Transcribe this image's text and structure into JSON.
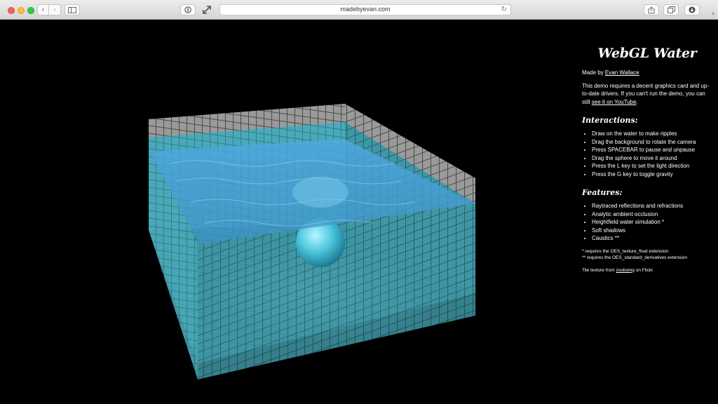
{
  "browser": {
    "url": "madebyevan.com",
    "icons": {
      "back": "chevron-left-icon",
      "forward": "chevron-right-icon",
      "sidebar": "sidebar-icon",
      "reader": "reader-icon",
      "fullscreen": "expand-icon",
      "reload": "reload-icon",
      "share": "share-icon",
      "tabs": "tabs-icon",
      "downloads": "download-icon",
      "new_tab": "plus-icon"
    }
  },
  "scene": {
    "description_icon": "pool-water-sphere-scene",
    "colors": {
      "water": "#3f9fd8",
      "tile": "#4fb8c8",
      "grout": "#123640",
      "sphere": "#5fd4e8",
      "rim_tile": "#9a9a9a"
    }
  },
  "sidebar": {
    "title": "WebGL Water",
    "made_by_prefix": "Made by ",
    "author": "Evan Wallace",
    "intro_text": "This demo requires a decent graphics card and up-to-date drivers. If you can't run the demo, you can still ",
    "youtube_link": "see it on YouTube",
    "intro_end": ".",
    "interactions_heading": "Interactions:",
    "interactions": [
      "Draw on the water to make ripples",
      "Drag the background to rotate the camera",
      "Press SPACEBAR to pause and unpause",
      "Drag the sphere to move it around",
      "Press the L key to set the light direction",
      "Press the G key to toggle gravity"
    ],
    "features_heading": "Features:",
    "features": [
      "Raytraced reflections and refractions",
      "Analytic ambient occlusion",
      "Heightfield water simulation *",
      "Soft shadows",
      "Caustics **"
    ],
    "footnote_1": "* requires the OES_texture_float extension",
    "footnote_2": "** requires the OES_standard_derivatives extension",
    "credit_prefix": "Tile texture from ",
    "credit_link": "zooboing",
    "credit_suffix": " on Flickr"
  }
}
